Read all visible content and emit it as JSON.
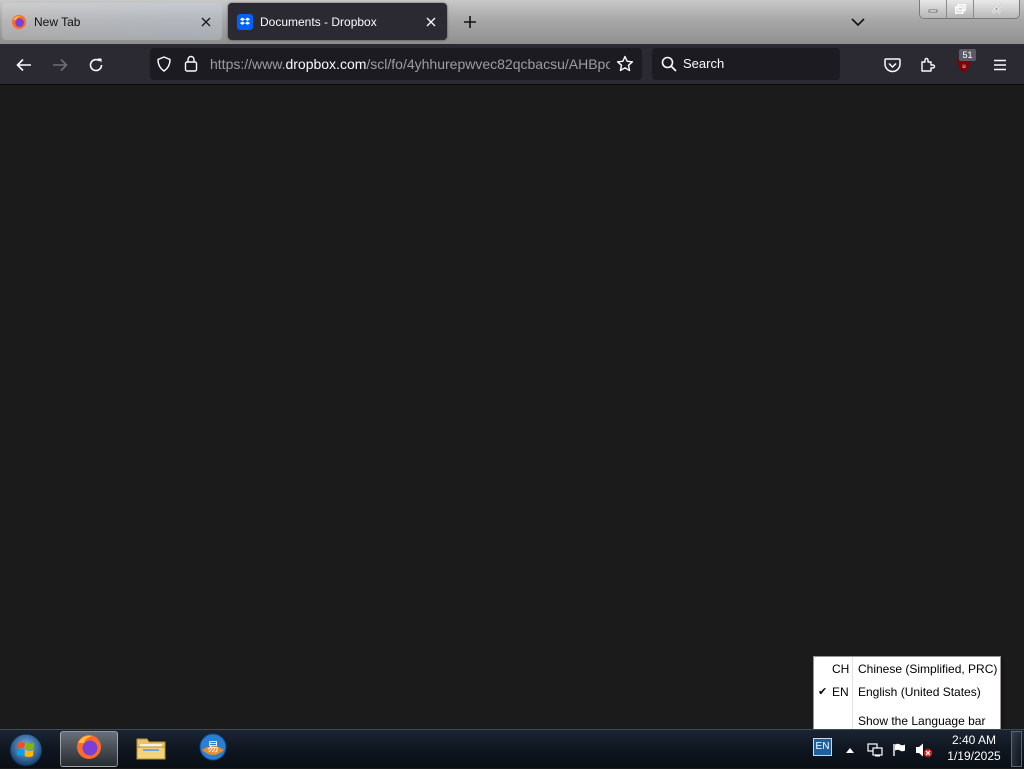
{
  "browser": {
    "tabs": [
      {
        "title": "New Tab",
        "active": false,
        "icon": "firefox-icon"
      },
      {
        "title": "Documents - Dropbox",
        "active": true,
        "icon": "dropbox-icon"
      }
    ],
    "url": {
      "scheme": "https://www.",
      "host": "dropbox.com",
      "path": "/scl/fo/4yhhurepwvec82qcbacsu/AHBpc"
    },
    "search_placeholder": "Search",
    "extension_badge": "51",
    "accent_color": "#2b2a33",
    "urlbar_color": "#1c1b22"
  },
  "content": {
    "background": "#1c1b1b"
  },
  "language_menu": {
    "items": [
      {
        "code": "CH",
        "name": "Chinese (Simplified, PRC)",
        "checked": false
      },
      {
        "code": "EN",
        "name": "English (United States)",
        "checked": true
      },
      {
        "code": "",
        "name": "Show the Language bar",
        "checked": false
      }
    ]
  },
  "taskbar": {
    "apps": [
      {
        "name": "Firefox",
        "icon": "firefox-icon",
        "active": true
      },
      {
        "name": "Windows Explorer",
        "icon": "folder-icon",
        "active": false
      },
      {
        "name": "Input method",
        "icon": "ime-app-icon",
        "active": false
      }
    ],
    "language_indicator": "EN",
    "tray_icons": [
      "show-hidden-icons",
      "network-icon",
      "action-center-flag-icon",
      "volume-muted-icon"
    ],
    "time": "2:40 AM",
    "date": "1/19/2025"
  }
}
